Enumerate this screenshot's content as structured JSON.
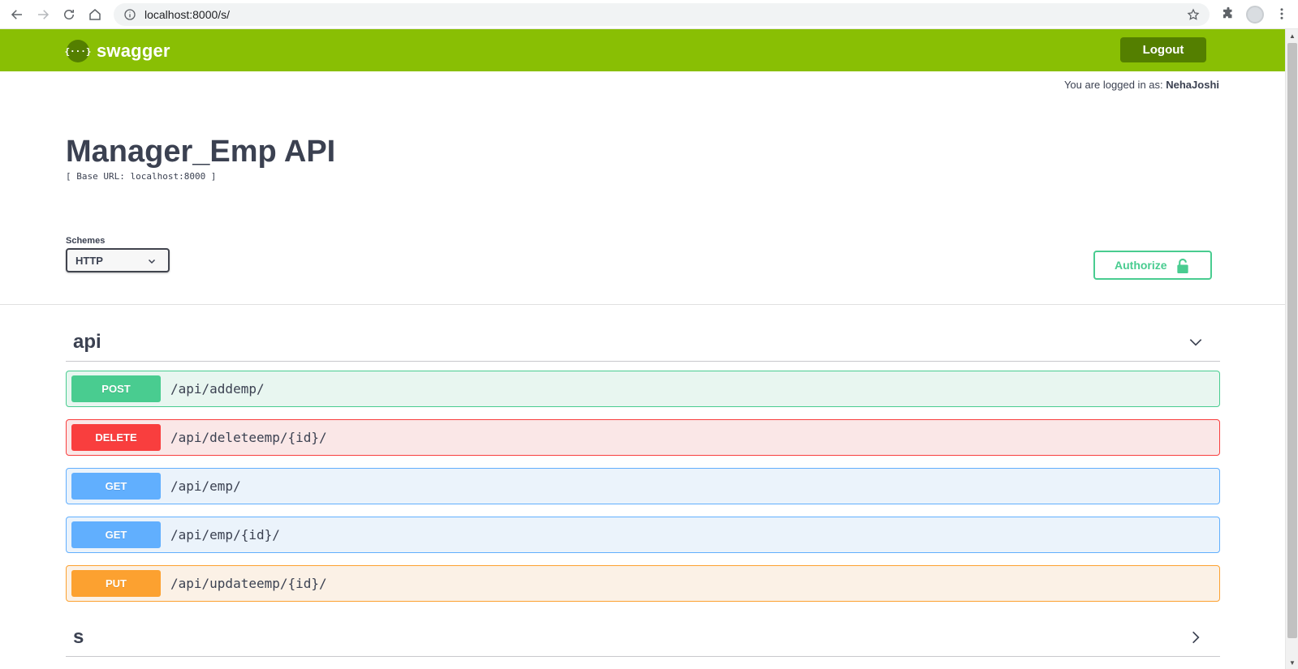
{
  "browser": {
    "url": "localhost:8000/s/",
    "icons": [
      "back-icon",
      "forward-icon",
      "reload-icon",
      "home-icon",
      "info-icon",
      "star-icon",
      "extensions-icon",
      "profile-icon",
      "menu-icon"
    ]
  },
  "topbar": {
    "logo_mark": "{···}",
    "logo_text": "swagger",
    "logout_label": "Logout",
    "brand_color": "#89bf04"
  },
  "session": {
    "prefix": "You are logged in as: ",
    "username": "NehaJoshi"
  },
  "info": {
    "title": "Manager_Emp API",
    "base_url": "[ Base URL: localhost:8000 ]"
  },
  "schemes": {
    "label": "Schemes",
    "selected": "HTTP"
  },
  "authorize": {
    "label": "Authorize"
  },
  "tags": [
    {
      "name": "api",
      "expanded": true,
      "operations": [
        {
          "method": "POST",
          "path": "/api/addemp/",
          "color": "#49cc90"
        },
        {
          "method": "DELETE",
          "path": "/api/deleteemp/{id}/",
          "color": "#f93e3e"
        },
        {
          "method": "GET",
          "path": "/api/emp/",
          "color": "#61affe"
        },
        {
          "method": "GET",
          "path": "/api/emp/{id}/",
          "color": "#61affe"
        },
        {
          "method": "PUT",
          "path": "/api/updateemp/{id}/",
          "color": "#fca130"
        }
      ]
    },
    {
      "name": "s",
      "expanded": false,
      "operations": []
    }
  ]
}
